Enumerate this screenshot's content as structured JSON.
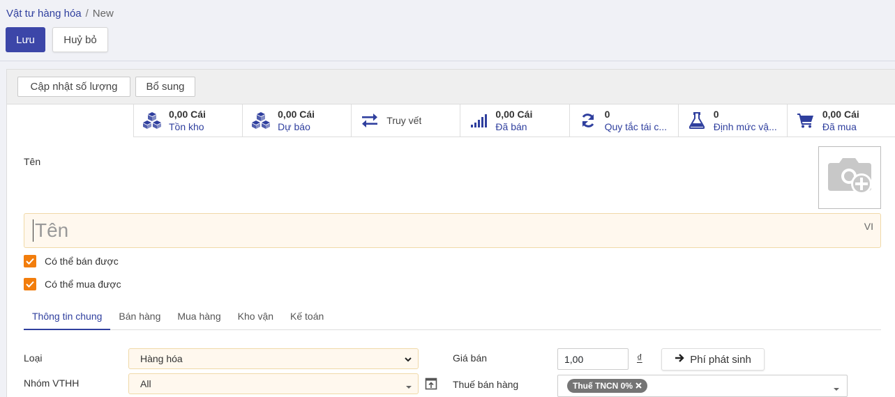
{
  "breadcrumb": {
    "parent": "Vật tư hàng hóa",
    "separator": "/",
    "current": "New"
  },
  "toolbar": {
    "save_label": "Lưu",
    "discard_label": "Huỷ bỏ"
  },
  "statusbar": {
    "update_qty_label": "Cập nhật số lượng",
    "supplement_label": "Bổ sung"
  },
  "smart_buttons": [
    {
      "value": "0,00 Cái",
      "label": "Tồn kho",
      "icon": "cubes-icon"
    },
    {
      "value": "0,00 Cái",
      "label": "Dự báo",
      "icon": "cubes-icon"
    },
    {
      "value": "",
      "label": "Truy vết",
      "icon": "exchange-icon"
    },
    {
      "value": "0,00 Cái",
      "label": "Đã bán",
      "icon": "signal-icon"
    },
    {
      "value": "0",
      "label": "Quy tắc tái c...",
      "icon": "refresh-icon"
    },
    {
      "value": "0",
      "label": "Định mức vậ...",
      "icon": "flask-icon"
    },
    {
      "value": "0,00 Cái",
      "label": "Đã mua",
      "icon": "shopping-cart-icon"
    }
  ],
  "form": {
    "name_label": "Tên",
    "name_placeholder": "Tên",
    "lang": "VI",
    "can_be_sold_label": "Có thể bán được",
    "can_be_purchased_label": "Có thể mua được"
  },
  "tabs": [
    "Thông tin chung",
    "Bán hàng",
    "Mua hàng",
    "Kho vận",
    "Kế toán"
  ],
  "general": {
    "type_label": "Loại",
    "type_value": "Hàng hóa",
    "group_label": "Nhóm VTHH",
    "group_value": "All",
    "price_label": "Giá bán",
    "price_value": "1,00",
    "currency": "₫",
    "extra_cost_label": "Phí phát sinh",
    "tax_label": "Thuế bán hàng",
    "tax_tag": "Thuế TNCN 0%"
  },
  "colors": {
    "primary": "#3c46a8",
    "accent_orange": "#f27d0c",
    "link": "#2f3f9e"
  }
}
